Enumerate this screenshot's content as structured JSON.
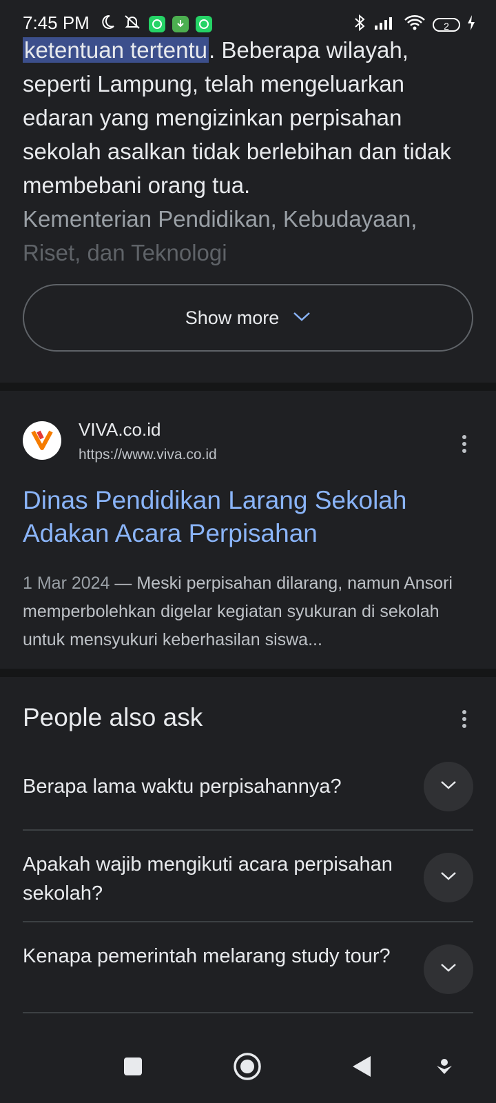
{
  "status_bar": {
    "time": "7:45 PM",
    "battery_level": "2",
    "icons": [
      "moon-icon",
      "notifications-off-icon",
      "whatsapp-icon",
      "download-icon",
      "whatsapp-icon",
      "bluetooth-icon",
      "signal-icon",
      "wifi-icon",
      "battery-icon",
      "charging-icon"
    ]
  },
  "snippet": {
    "highlight": "ketentuan tertentu",
    "text_after_highlight": ". Beberapa wilayah, seperti Lampung, telah mengeluarkan edaran yang mengizinkan perpisahan sekolah asalkan tidak berlebihan dan tidak membebani orang tua.",
    "fade_text": "Kementerian Pendidikan, Kebudayaan,",
    "fade_text_2": "Riset, dan Teknologi"
  },
  "show_more": {
    "label": "Show more"
  },
  "result": {
    "site_name": "VIVA.co.id",
    "url": "https://www.viva.co.id",
    "logo_letter": "V",
    "title": "Dinas Pendidikan Larang Sekolah Adakan Acara Perpisahan",
    "date": "1 Mar 2024",
    "snippet": " — Meski perpisahan dilarang, namun Ansori memperbolehkan digelar kegiatan syukuran di sekolah untuk mensyukuri keberhasilan siswa..."
  },
  "people_also_ask": {
    "heading": "People also ask",
    "questions": [
      "Berapa lama waktu perpisahannya?",
      "Apakah wajib mengikuti acara perpisahan sekolah?",
      "Kenapa pemerintah melarang study tour?"
    ]
  },
  "navigation": [
    "recent-apps-icon",
    "home-icon",
    "back-icon",
    "assistant-icon"
  ],
  "colors": {
    "background": "#1f2023",
    "link": "#8ab4f8",
    "highlight": "#3c4f8c",
    "whatsapp": "#25d366",
    "download_app": "#4caf50"
  }
}
